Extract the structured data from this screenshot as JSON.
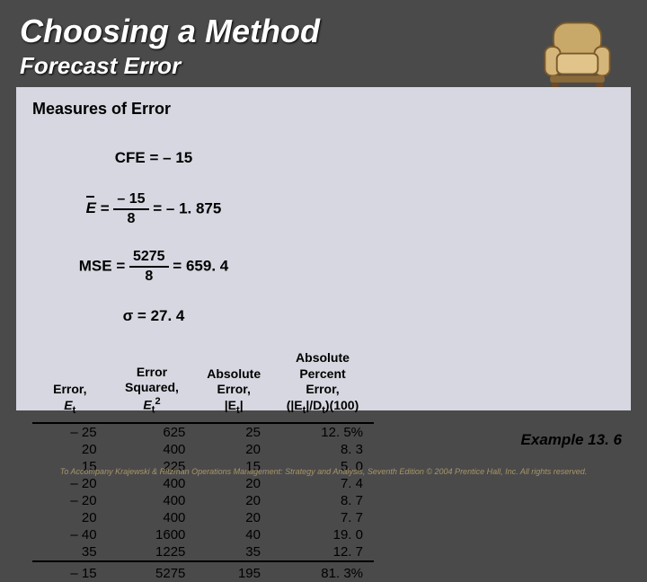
{
  "title": "Choosing a Method",
  "subtitle": "Forecast Error",
  "panel_heading": "Measures of Error",
  "equations": {
    "cfe": "CFE = – 15",
    "ebar_lhs": "E",
    "ebar_eq": " = ",
    "ebar_num": "– 15",
    "ebar_den": "8",
    "ebar_rhs": " = – 1. 875",
    "mse_lhs": "MSE = ",
    "mse_num": "5275",
    "mse_den": "8",
    "mse_rhs": " = 659. 4",
    "sigma": "σ = 27. 4"
  },
  "table": {
    "headers": {
      "h1a": "Error,",
      "h1b": "E",
      "h1sub": "t",
      "h2a": "Error",
      "h2b": "Squared,",
      "h2c": "E",
      "h2sub": "t",
      "h2sup": "2",
      "h3a": "Absolute",
      "h3b": "Error,",
      "h3c": "|E",
      "h3sub": "t",
      "h3d": "|",
      "h4a": "Absolute",
      "h4b": "Percent",
      "h4c": "Error,",
      "h4d": "(|E",
      "h4sub": "t",
      "h4e": "|/D",
      "h4sub2": "t",
      "h4f": ")(100)"
    },
    "rows": [
      {
        "et": "– 25",
        "sq": "625",
        "abs": "25",
        "pct": "12. 5%"
      },
      {
        "et": "20",
        "sq": "400",
        "abs": "20",
        "pct": "8. 3"
      },
      {
        "et": "15",
        "sq": "225",
        "abs": "15",
        "pct": "5. 0"
      },
      {
        "et": "– 20",
        "sq": "400",
        "abs": "20",
        "pct": "7. 4"
      },
      {
        "et": "– 20",
        "sq": "400",
        "abs": "20",
        "pct": "8. 7"
      },
      {
        "et": "20",
        "sq": "400",
        "abs": "20",
        "pct": "7. 7"
      },
      {
        "et": "– 40",
        "sq": "1600",
        "abs": "40",
        "pct": "19. 0"
      },
      {
        "et": "35",
        "sq": "1225",
        "abs": "35",
        "pct": "12. 7"
      }
    ],
    "totals": {
      "et": "– 15",
      "sq": "5275",
      "abs": "195",
      "pct": "81. 3%"
    }
  },
  "example_label": "Example 13. 6",
  "footer": "To Accompany Krajewski & Ritzman Operations Management: Strategy and Analysis, Seventh Edition © 2004 Prentice Hall, Inc. All rights reserved.",
  "chart_data": {
    "type": "table",
    "title": "Measures of Error",
    "columns": [
      "Error Et",
      "Error Squared Et^2",
      "Absolute Error |Et|",
      "Absolute Percent Error (|Et|/Dt)(100)"
    ],
    "rows": [
      [
        -25,
        625,
        25,
        12.5
      ],
      [
        20,
        400,
        20,
        8.3
      ],
      [
        15,
        225,
        15,
        5.0
      ],
      [
        -20,
        400,
        20,
        7.4
      ],
      [
        -20,
        400,
        20,
        8.7
      ],
      [
        20,
        400,
        20,
        7.7
      ],
      [
        -40,
        1600,
        40,
        19.0
      ],
      [
        35,
        1225,
        35,
        12.7
      ]
    ],
    "totals": [
      -15,
      5275,
      195,
      81.3
    ],
    "derived": {
      "CFE": -15,
      "E_bar": -1.875,
      "MSE": 659.4,
      "sigma": 27.4
    }
  }
}
